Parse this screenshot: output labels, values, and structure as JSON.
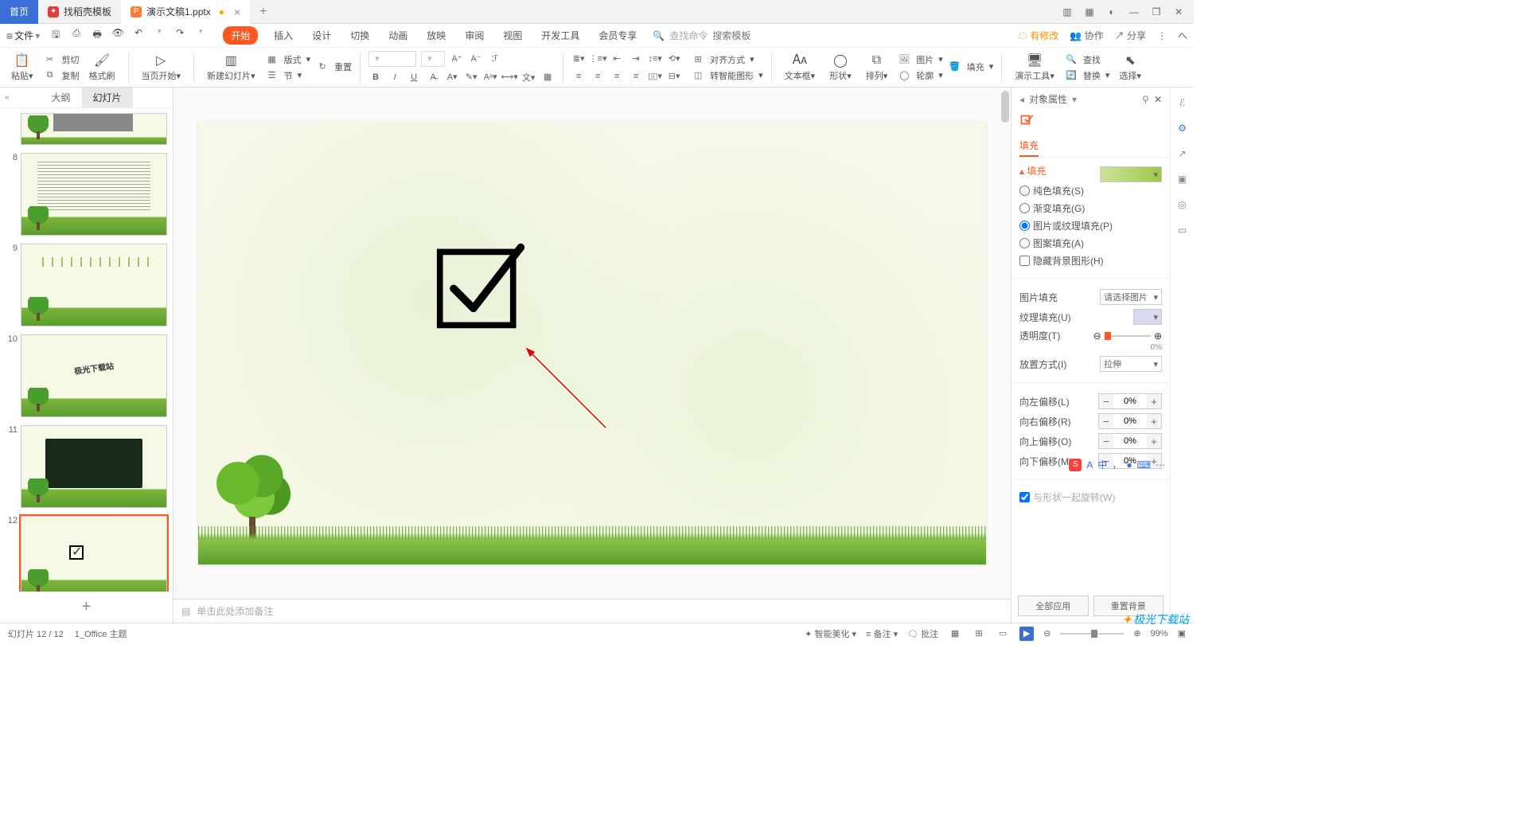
{
  "titlebar": {
    "home": "首页",
    "tab1": "找稻壳模板",
    "tab2": "演示文稿1.pptx",
    "dirty": "●",
    "plus": "+"
  },
  "win": {
    "min": "—",
    "max": "❐",
    "close": "✕",
    "grid": "▦",
    "layout": "▥",
    "user": "◐"
  },
  "menubar": {
    "file": "文件",
    "menus": [
      "开始",
      "插入",
      "设计",
      "切换",
      "动画",
      "放映",
      "审阅",
      "视图",
      "开发工具",
      "会员专享"
    ],
    "searchIcon": "🔍",
    "searchHint": "查找命令",
    "templateHint": "搜索模板",
    "pending": "有修改",
    "coop": "协作",
    "share": "分享"
  },
  "ribbon": {
    "paste": "粘贴",
    "cut": "剪切",
    "copy": "复制",
    "fmt": "格式刷",
    "startFrom": "当页开始",
    "newSlide": "新建幻灯片",
    "layout": "版式",
    "section": "节",
    "reset": "重置",
    "align": "对齐方式",
    "textbox": "文本框",
    "shape": "形状",
    "arrange": "排列",
    "pic": "图片",
    "fill": "填充",
    "find": "查找",
    "outline": "轮廓",
    "presTool": "演示工具",
    "replace": "替换",
    "smart": "转智能图形",
    "select": "选择"
  },
  "thumbs": {
    "outline": "大纲",
    "slides": "幻灯片",
    "ids": [
      "8",
      "9",
      "10",
      "11",
      "12"
    ],
    "slide10Text": "极光下载站"
  },
  "notesPlaceholder": "单击此处添加备注",
  "panel": {
    "title": "对象属性",
    "fillTab": "填充",
    "fillSection": "填充",
    "solid": "纯色填充(S)",
    "gradient": "渐变填充(G)",
    "pictex": "图片或纹理填充(P)",
    "pattern": "图案填充(A)",
    "hidebg": "隐藏背景图形(H)",
    "picFill": "图片填充",
    "picSel": "请选择图片",
    "texFill": "纹理填充(U)",
    "opacity": "透明度(T)",
    "opVal": "0%",
    "place": "放置方式(I)",
    "placeVal": "拉伸",
    "offL": "向左偏移(L)",
    "offR": "向右偏移(R)",
    "offT": "向上偏移(O)",
    "offB": "向下偏移(M)",
    "zero": "0%",
    "rotate": "与形状一起旋转(W)",
    "applyAll": "全部应用",
    "resetBg": "重置背景"
  },
  "status": {
    "slideOf": "幻灯片 12 / 12",
    "theme": "1_Office 主题",
    "beautify": "智能美化",
    "notes": "备注",
    "comments": "批注",
    "zoom": "99%"
  },
  "watermark": "极光下载站",
  "ime": {
    "a": "A",
    "items": [
      "中",
      "，",
      "●",
      "⌨",
      "⋯"
    ]
  }
}
